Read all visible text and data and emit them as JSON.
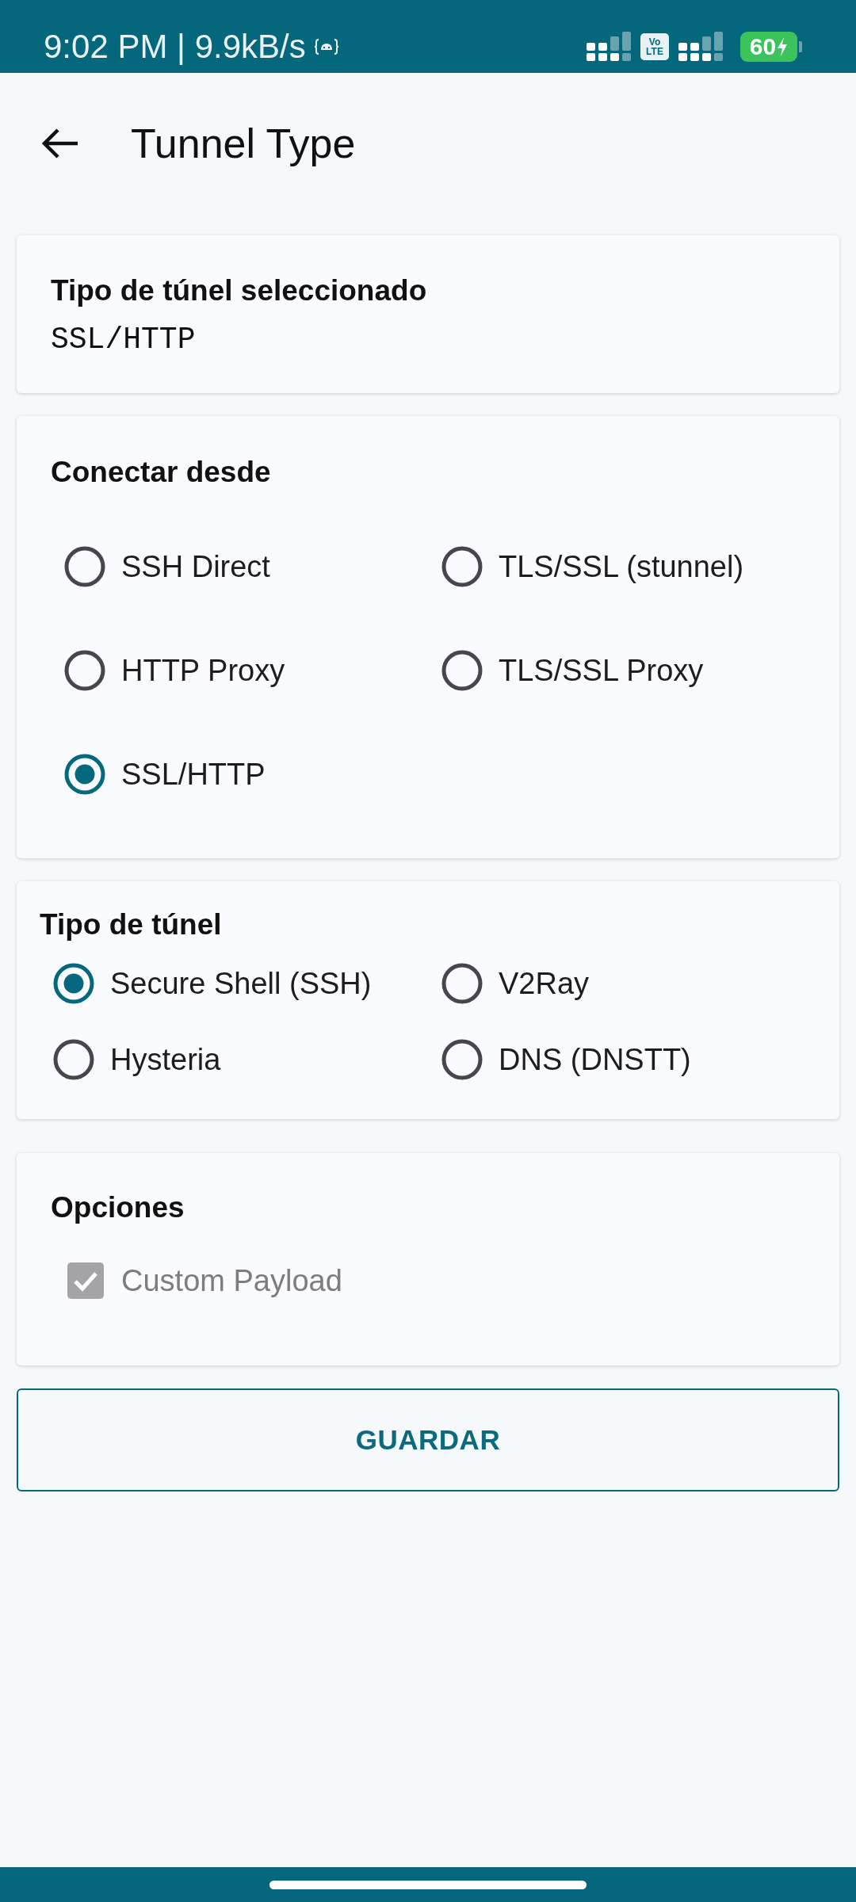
{
  "status_bar": {
    "text": "9:02 PM | 9.9kB/s",
    "volte": [
      "Vo",
      "LTE"
    ],
    "battery": "60"
  },
  "header": {
    "title": "Tunnel Type"
  },
  "selected_card": {
    "title": "Tipo de túnel seleccionado",
    "value": "SSL/HTTP"
  },
  "connect_from": {
    "title": "Conectar desde",
    "options": [
      {
        "label": "SSH Direct",
        "selected": false
      },
      {
        "label": "TLS/SSL (stunnel)",
        "selected": false
      },
      {
        "label": "HTTP Proxy",
        "selected": false
      },
      {
        "label": "TLS/SSL Proxy",
        "selected": false
      },
      {
        "label": "SSL/HTTP",
        "selected": true
      }
    ]
  },
  "tunnel_type": {
    "title": "Tipo de túnel",
    "options": [
      {
        "label": "Secure Shell (SSH)",
        "selected": true
      },
      {
        "label": "V2Ray",
        "selected": false
      },
      {
        "label": "Hysteria",
        "selected": false
      },
      {
        "label": "DNS (DNSTT)",
        "selected": false
      }
    ]
  },
  "options": {
    "title": "Opciones",
    "items": [
      {
        "label": "Custom Payload",
        "checked": true,
        "disabled": true
      }
    ]
  },
  "save_button": {
    "label": "GUARDAR"
  }
}
